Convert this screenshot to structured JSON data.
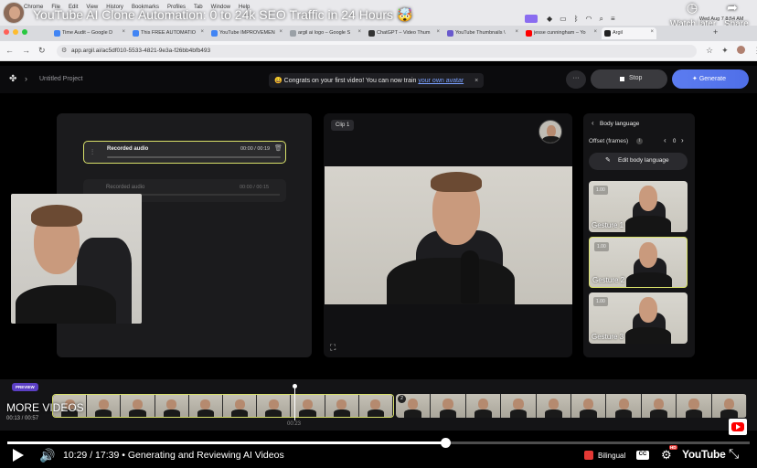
{
  "video": {
    "title": "YouTube AI Clone Automation: 0 to 24k SEO Traffic in 24 Hours 🤯",
    "watch_later": "Watch later",
    "share": "Share",
    "more_videos": "MORE VIDEOS",
    "more_videos_sub": "00:13 / 00:57",
    "current_time": "10:29",
    "duration": "17:39",
    "chapter": "Generating and Reviewing AI Videos",
    "time_separator": "/",
    "chapter_separator": "•",
    "bilingual": "Bilingual",
    "cc": "CC",
    "hd": "HD",
    "brand": "YouTube",
    "progress": 0.59
  },
  "macos": {
    "menu": [
      "Chrome",
      "File",
      "Edit",
      "View",
      "History",
      "Bookmarks",
      "Profiles",
      "Tab",
      "Window",
      "Help"
    ],
    "clock": "Wed Aug 7  8:54 AM"
  },
  "browser": {
    "tabs": [
      {
        "label": "Time Audit – Google D",
        "color": "#4285f4"
      },
      {
        "label": "This FREE AUTOMATIO",
        "color": "#4285f4"
      },
      {
        "label": "YouTube IMPROVEMEN",
        "color": "#4285f4"
      },
      {
        "label": "argil ai logo – Google S",
        "color": "#9aa0a6"
      },
      {
        "label": "ChatGPT – Video Thum",
        "color": "#333333"
      },
      {
        "label": "YouTube Thumbnails \\",
        "color": "#6a5acd"
      },
      {
        "label": "jesse cunningham – Yo",
        "color": "#ff0000"
      },
      {
        "label": "Argil",
        "color": "#222222"
      }
    ],
    "url": "app.argil.ai/ac5df010-5533-4821-9e3a-f26bb4bfb493"
  },
  "app": {
    "project_name": "Untitled Project",
    "banner_emoji": "😀",
    "banner_text": "Congrats on your first video! You can now train ",
    "banner_link": "your own avatar",
    "banner_close": "×",
    "more": "···",
    "stop": "Stop",
    "generate": "Generate",
    "generate_color": "#4f6fe8",
    "audio": {
      "recorded_label": "Recorded audio",
      "recorded_time": "00:00 / 00:19",
      "second_label": "Recorded audio",
      "second_time": "00:00 / 00:15"
    },
    "clip_label": "Clip 1",
    "side_panel": {
      "title": "Body language",
      "offset_label": "Offset (frames)",
      "offset_value": "0",
      "edit_button": "Edit body language",
      "gestures": [
        {
          "badge": "1.00",
          "name": "Gesture 1"
        },
        {
          "badge": "1.00",
          "name": "Gesture 2"
        },
        {
          "badge": "1.00",
          "name": "Gesture 3"
        }
      ]
    },
    "timeline": {
      "preview_badge": "PREVIEW",
      "playhead_time": "00:23",
      "clip2_number": "2"
    },
    "accent_color": "#d8e06a"
  }
}
